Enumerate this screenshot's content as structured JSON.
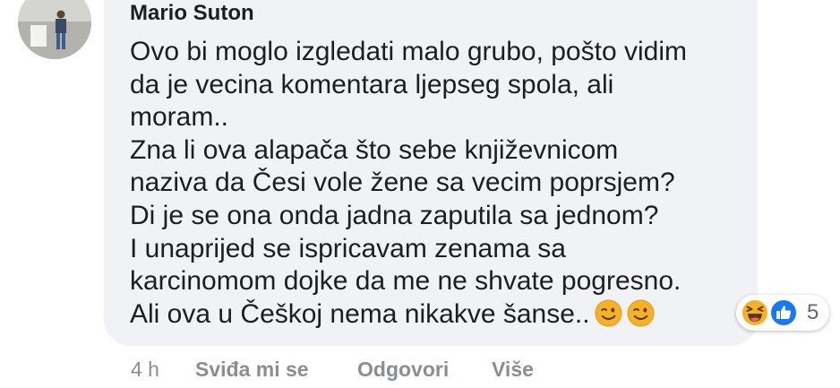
{
  "comment": {
    "author": "Mario Suton",
    "lines": [
      "Ovo bi moglo izgledati malo grubo, pošto vidim",
      "da je vecina komentara ljepseg spola, ali",
      "moram..",
      "Zna li ova alapača što sebe književnicom",
      "naziva da Česi vole žene sa vecim poprsjem?",
      "Di je se ona onda jadna zaputila sa jednom?",
      "I unaprijed se ispricavam zenama sa",
      "karcinomom dojke da me ne shvate pogresno.",
      "Ali ova u Češkoj nema nikakve šanse.."
    ],
    "trailing_emojis": [
      "winking-face",
      "winking-face"
    ]
  },
  "reactions": {
    "icons": [
      "haha-icon",
      "like-icon"
    ],
    "count": "5"
  },
  "actions": {
    "timestamp": "4 h",
    "like": "Sviđa mi se",
    "reply": "Odgovori",
    "more": "Više"
  },
  "colors": {
    "bubble": "#f0f2f5",
    "text": "#1c1e21",
    "meta": "#8a8d91",
    "like_blue": "#1877f2",
    "emoji_yellow": "#f7b125"
  }
}
